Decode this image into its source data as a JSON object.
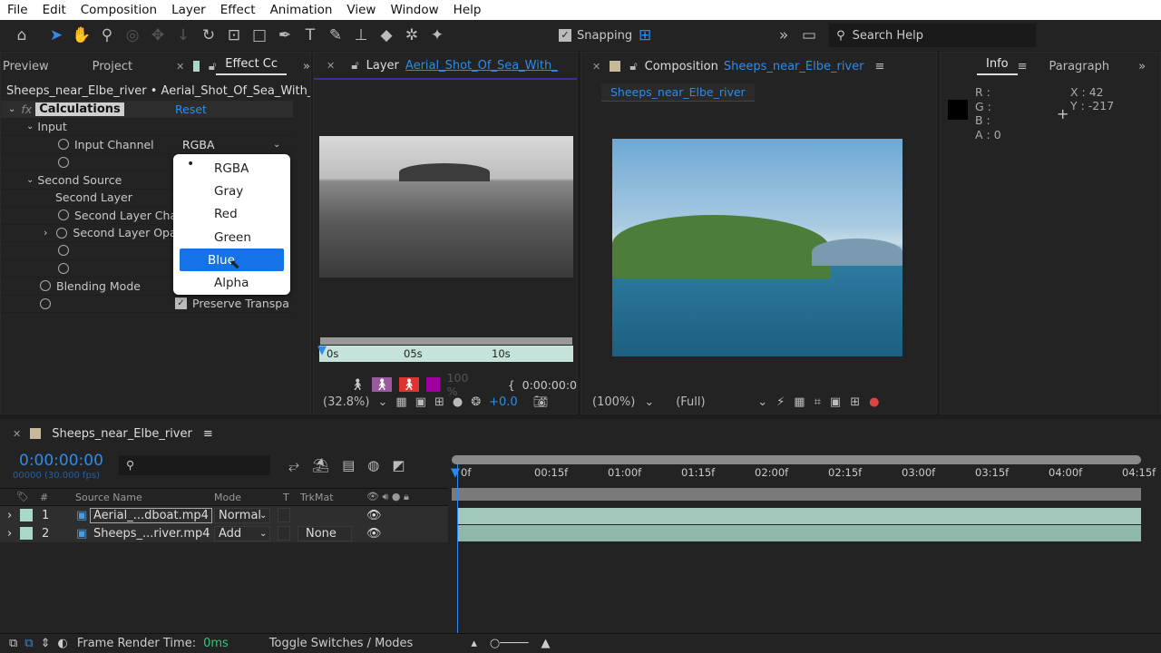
{
  "menu": [
    "File",
    "Edit",
    "Composition",
    "Layer",
    "Effect",
    "Animation",
    "View",
    "Window",
    "Help"
  ],
  "toolbar": {
    "snapping": "Snapping",
    "search_help": "Search Help"
  },
  "left_panel": {
    "tabs": [
      "Preview",
      "Project",
      "Effect Cc"
    ],
    "breadcrumb": "Sheeps_near_Elbe_river • Aerial_Shot_Of_Sea_With_Speed",
    "effect": "Calculations",
    "reset": "Reset",
    "input": "Input",
    "input_channel": "Input Channel",
    "input_channel_value": "RGBA",
    "second_source": "Second Source",
    "second_layer": "Second Layer",
    "second_layer_channel": "Second Layer Cha",
    "second_layer_opacity": "Second Layer Opa",
    "blending_mode": "Blending Mode",
    "preserve": "Preserve Transpa"
  },
  "dropdown": {
    "options": [
      "RGBA",
      "Gray",
      "Red",
      "Green",
      "Blue",
      "Alpha"
    ],
    "current": "RGBA",
    "highlighted": "Blue"
  },
  "layer_panel": {
    "label": "Layer",
    "name": "Aerial_Shot_Of_Sea_With_",
    "ruler": [
      "0s",
      "05s",
      "10s"
    ],
    "opacity": "100 %",
    "timecode": "0:00:00:0",
    "zoom": "(32.8%)",
    "exposure": "+0.0"
  },
  "comp_panel": {
    "label": "Composition",
    "name": "Sheeps_near_Elbe_river",
    "subtab": "Sheeps_near_Elbe_river",
    "zoom": "(100%)",
    "resolution": "(Full)"
  },
  "info_panel": {
    "tabs": [
      "Info",
      "Paragraph"
    ],
    "r": "R :",
    "g": "G :",
    "b": "B :",
    "a": "A :  0",
    "x": "X : 42",
    "y": "Y : -217"
  },
  "timeline": {
    "comp": "Sheeps_near_Elbe_river",
    "time": "0:00:00:00",
    "frames": "00000 (30.000 fps)",
    "headers": {
      "num": "#",
      "source": "Source Name",
      "mode": "Mode",
      "t": "T",
      "trkmat": "TrkMat"
    },
    "layers": [
      {
        "num": "1",
        "name": "Aerial_...dboat.mp4",
        "mode": "Normal",
        "trkmat": ""
      },
      {
        "num": "2",
        "name": "Sheeps_...river.mp4",
        "mode": "Add",
        "trkmat": "None"
      }
    ],
    "ruler": [
      "0f",
      "00:15f",
      "01:00f",
      "01:15f",
      "02:00f",
      "02:15f",
      "03:00f",
      "03:15f",
      "04:00f",
      "04:15f"
    ],
    "render_label": "Frame Render Time:",
    "render_value": "0ms",
    "toggle": "Toggle Switches / Modes"
  },
  "colors": {
    "accent": "#2d8ceb",
    "label": "#a8d8c8",
    "highlight": "#1473e6"
  }
}
